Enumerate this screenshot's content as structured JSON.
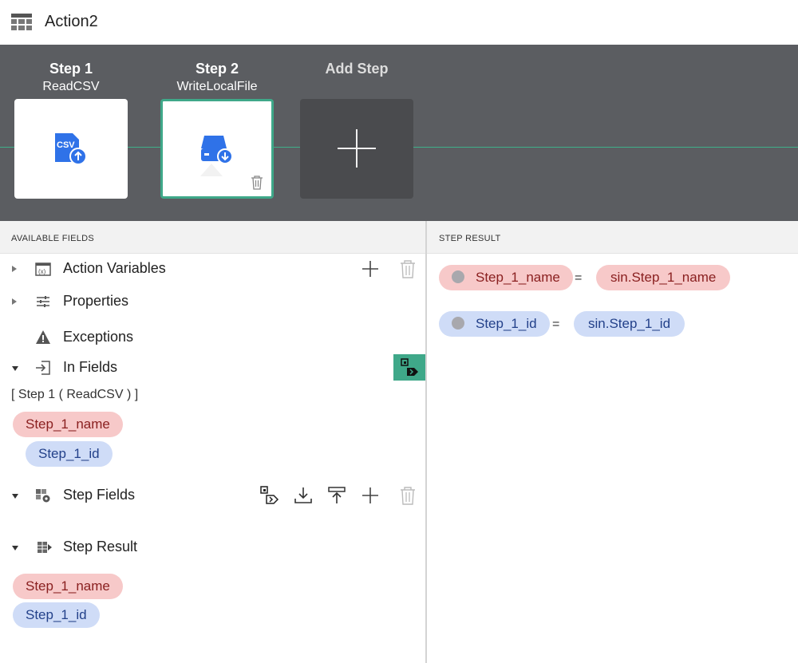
{
  "header": {
    "title": "Action2",
    "icon": "table-icon"
  },
  "steps": [
    {
      "title": "Step 1",
      "subtitle": "ReadCSV",
      "icon": "csv-upload-icon"
    },
    {
      "title": "Step 2",
      "subtitle": "WriteLocalFile",
      "icon": "drive-download-icon",
      "active": true
    },
    {
      "title": "Add Step",
      "icon": "plus-icon"
    }
  ],
  "available_fields": {
    "heading": "AVAILABLE FIELDS",
    "nodes": {
      "action_variables": "Action Variables",
      "properties": "Properties",
      "exceptions": "Exceptions",
      "in_fields": "In Fields",
      "step_fields": "Step Fields",
      "step_result": "Step Result"
    },
    "in_fields_source": "[ Step 1 ( ReadCSV ) ]",
    "in_fields_items": [
      "Step_1_name",
      "Step_1_id"
    ],
    "step_result_items": [
      "Step_1_name",
      "Step_1_id"
    ]
  },
  "step_result": {
    "heading": "STEP RESULT",
    "mappings": [
      {
        "field": "Step_1_name",
        "eq": "=",
        "value": "sin.Step_1_name"
      },
      {
        "field": "Step_1_id",
        "eq": "=",
        "value": "sin.Step_1_id"
      }
    ]
  },
  "colors": {
    "accent": "#3fa889",
    "bar": "#5b5d61",
    "red_pill": "#f7c9c9",
    "blue_pill": "#cfdcf7"
  }
}
